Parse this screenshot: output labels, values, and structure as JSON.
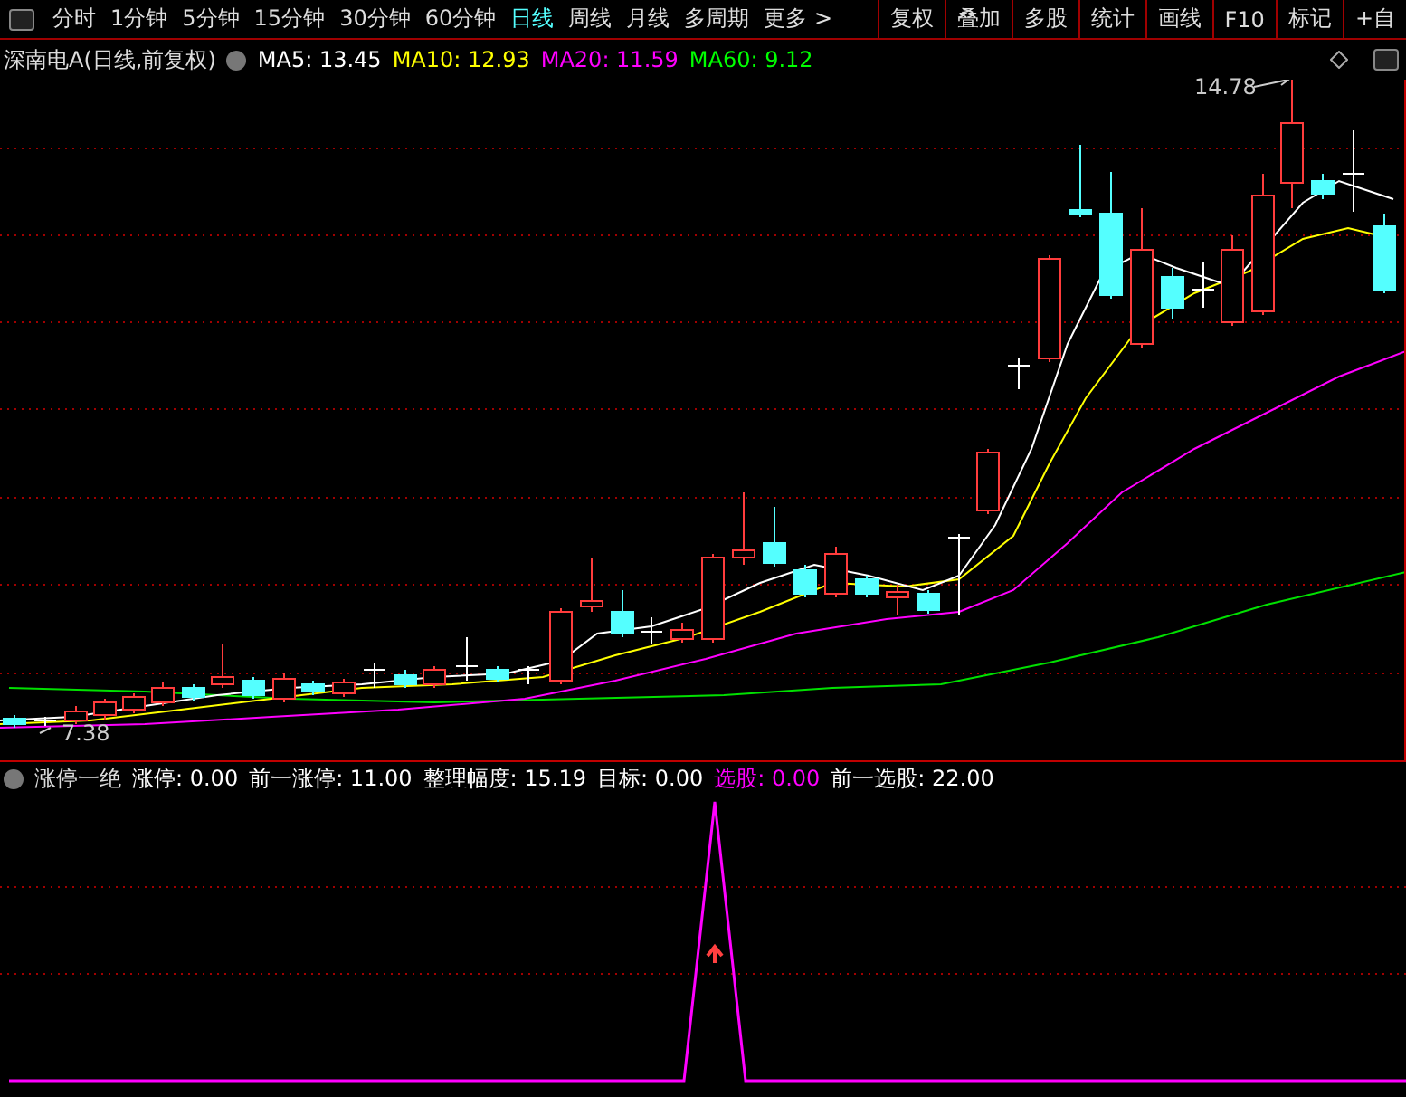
{
  "toolbar": {
    "periods": [
      {
        "label": "分时",
        "selected": false
      },
      {
        "label": "1分钟",
        "selected": false
      },
      {
        "label": "5分钟",
        "selected": false
      },
      {
        "label": "15分钟",
        "selected": false
      },
      {
        "label": "30分钟",
        "selected": false
      },
      {
        "label": "60分钟",
        "selected": false
      },
      {
        "label": "日线",
        "selected": true
      },
      {
        "label": "周线",
        "selected": false
      },
      {
        "label": "月线",
        "selected": false
      },
      {
        "label": "多周期",
        "selected": false
      }
    ],
    "more": "更多 >",
    "buttons": [
      "复权",
      "叠加",
      "多股",
      "统计",
      "画线",
      "F10",
      "标记",
      "+自"
    ]
  },
  "main_chart": {
    "title": "深南电A(日线,前复权)",
    "indicators": [
      {
        "label": "MA5: 13.45",
        "color": "#ffffff"
      },
      {
        "label": "MA10: 12.93",
        "color": "#ffff00"
      },
      {
        "label": "MA20: 11.59",
        "color": "#ff00ff"
      },
      {
        "label": "MA60: 9.12",
        "color": "#00ff00"
      }
    ],
    "high_label": "14.78",
    "low_label": "7.38"
  },
  "sub_chart": {
    "title": "涨停一绝",
    "indicators": [
      {
        "label": "涨停: 0.00",
        "color": "#ffffff"
      },
      {
        "label": "前一涨停: 11.00",
        "color": "#ffffff"
      },
      {
        "label": "整理幅度: 15.19",
        "color": "#ffffff"
      },
      {
        "label": "目标: 0.00",
        "color": "#ffffff"
      },
      {
        "label": "选股: 0.00",
        "color": "#ff00ff"
      },
      {
        "label": "前一选股: 22.00",
        "color": "#ffffff"
      }
    ]
  }
}
